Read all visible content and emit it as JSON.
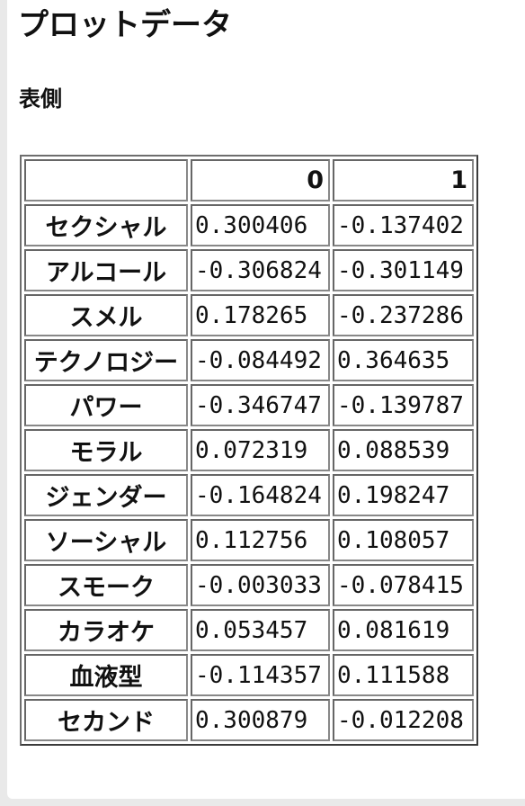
{
  "page": {
    "title": "プロットデータ",
    "section_title": "表側"
  },
  "table": {
    "columns": [
      "",
      "0",
      "1"
    ],
    "rows": [
      {
        "label": "セクシャル",
        "c0": "0.300406",
        "c1": "-0.137402"
      },
      {
        "label": "アルコール",
        "c0": "-0.306824",
        "c1": "-0.301149"
      },
      {
        "label": "スメル",
        "c0": "0.178265",
        "c1": "-0.237286"
      },
      {
        "label": "テクノロジー",
        "c0": "-0.084492",
        "c1": "0.364635"
      },
      {
        "label": "パワー",
        "c0": "-0.346747",
        "c1": "-0.139787"
      },
      {
        "label": "モラル",
        "c0": "0.072319",
        "c1": "0.088539"
      },
      {
        "label": "ジェンダー",
        "c0": "-0.164824",
        "c1": "0.198247"
      },
      {
        "label": "ソーシャル",
        "c0": "0.112756",
        "c1": "0.108057"
      },
      {
        "label": "スモーク",
        "c0": "-0.003033",
        "c1": "-0.078415"
      },
      {
        "label": "カラオケ",
        "c0": "0.053457",
        "c1": "0.081619"
      },
      {
        "label": "血液型",
        "c0": "-0.114357",
        "c1": "0.111588"
      },
      {
        "label": "セカンド",
        "c0": "0.300879",
        "c1": "-0.012208"
      }
    ]
  }
}
